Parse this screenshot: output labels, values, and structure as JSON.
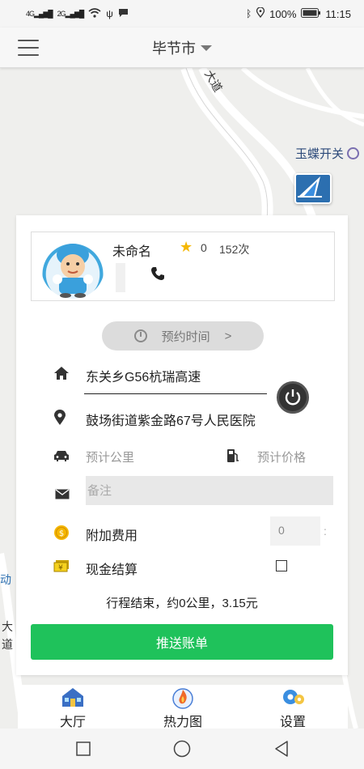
{
  "status_bar": {
    "signal_left": "4G",
    "signal_right": "2G",
    "battery": "100%",
    "time": "11:15"
  },
  "header": {
    "city": "毕节市"
  },
  "map": {
    "road_label": "大道",
    "poi_label": "玉蝶开关",
    "left_label_1": "动",
    "left_label_2": "大",
    "left_label_3": "道"
  },
  "driver": {
    "name": "未命名",
    "rating": "0",
    "trips": "152次"
  },
  "order": {
    "schedule_label": "预约时间",
    "schedule_arrow": ">",
    "from_address": "东关乡G56杭瑞高速",
    "to_address": "鼓场街道紫金路67号人民医院",
    "est_distance_placeholder": "预计公里",
    "est_price_placeholder": "预计价格",
    "remarks_placeholder": "备注",
    "extra_fee_label": "附加费用",
    "extra_fee_value": "0",
    "extra_fee_sep": ":",
    "cash_payment_label": "现金结算",
    "summary": "行程结束，约0公里，3.15元",
    "push_button": "推送账单"
  },
  "tabs": [
    {
      "label": "大厅",
      "icon": "hall-icon"
    },
    {
      "label": "热力图",
      "icon": "heatmap-icon"
    },
    {
      "label": "设置",
      "icon": "settings-icon"
    }
  ],
  "colors": {
    "accent_green": "#1fc25b",
    "star": "#f5b700",
    "map_bg": "#efefed"
  }
}
